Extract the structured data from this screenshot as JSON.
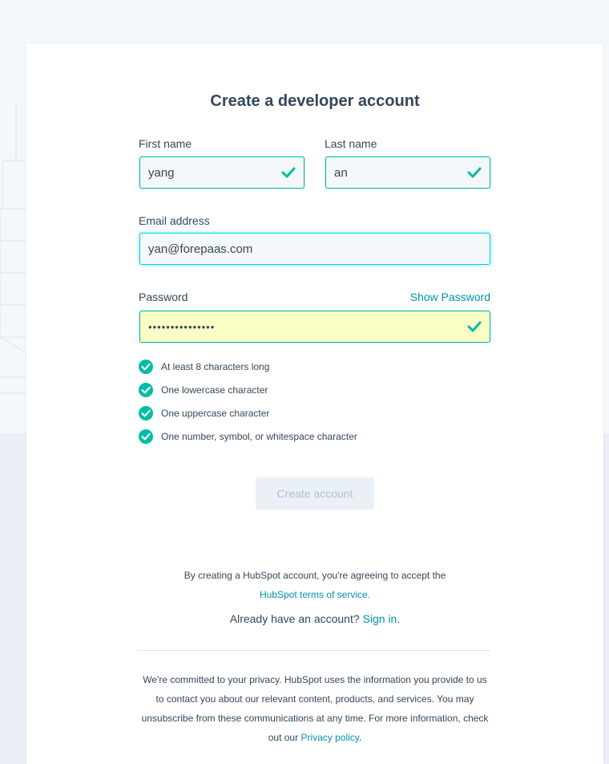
{
  "title": "Create a developer account",
  "form": {
    "first_name_label": "First name",
    "first_name_value": "yang",
    "last_name_label": "Last name",
    "last_name_value": "an",
    "email_label": "Email address",
    "email_value": "yan@forepaas.com",
    "password_label": "Password",
    "password_value": "•••••••••••••••",
    "show_password_label": "Show Password"
  },
  "password_rules": [
    "At least 8 characters long",
    "One lowercase character",
    "One uppercase character",
    "One number, symbol, or whitespace character"
  ],
  "create_button_label": "Create account",
  "terms": {
    "text": "By creating a HubSpot account, you're agreeing to accept the",
    "link": "HubSpot terms of service."
  },
  "signin": {
    "text": "Already have an account?",
    "link": "Sign in",
    "suffix": "."
  },
  "privacy": {
    "text": "We're committed to your privacy. HubSpot uses the information you provide to us to contact you about our relevant content, products, and services. You may unsubscribe from these communications at any time. For more information, check out our",
    "link": "Privacy policy",
    "suffix": "."
  },
  "colors": {
    "accent": "#00bda5",
    "link": "#0091ae",
    "text": "#33475b",
    "autofill": "#fafdc4"
  },
  "icons": {
    "valid": "check-icon",
    "rule_ok": "check-circle-icon"
  }
}
